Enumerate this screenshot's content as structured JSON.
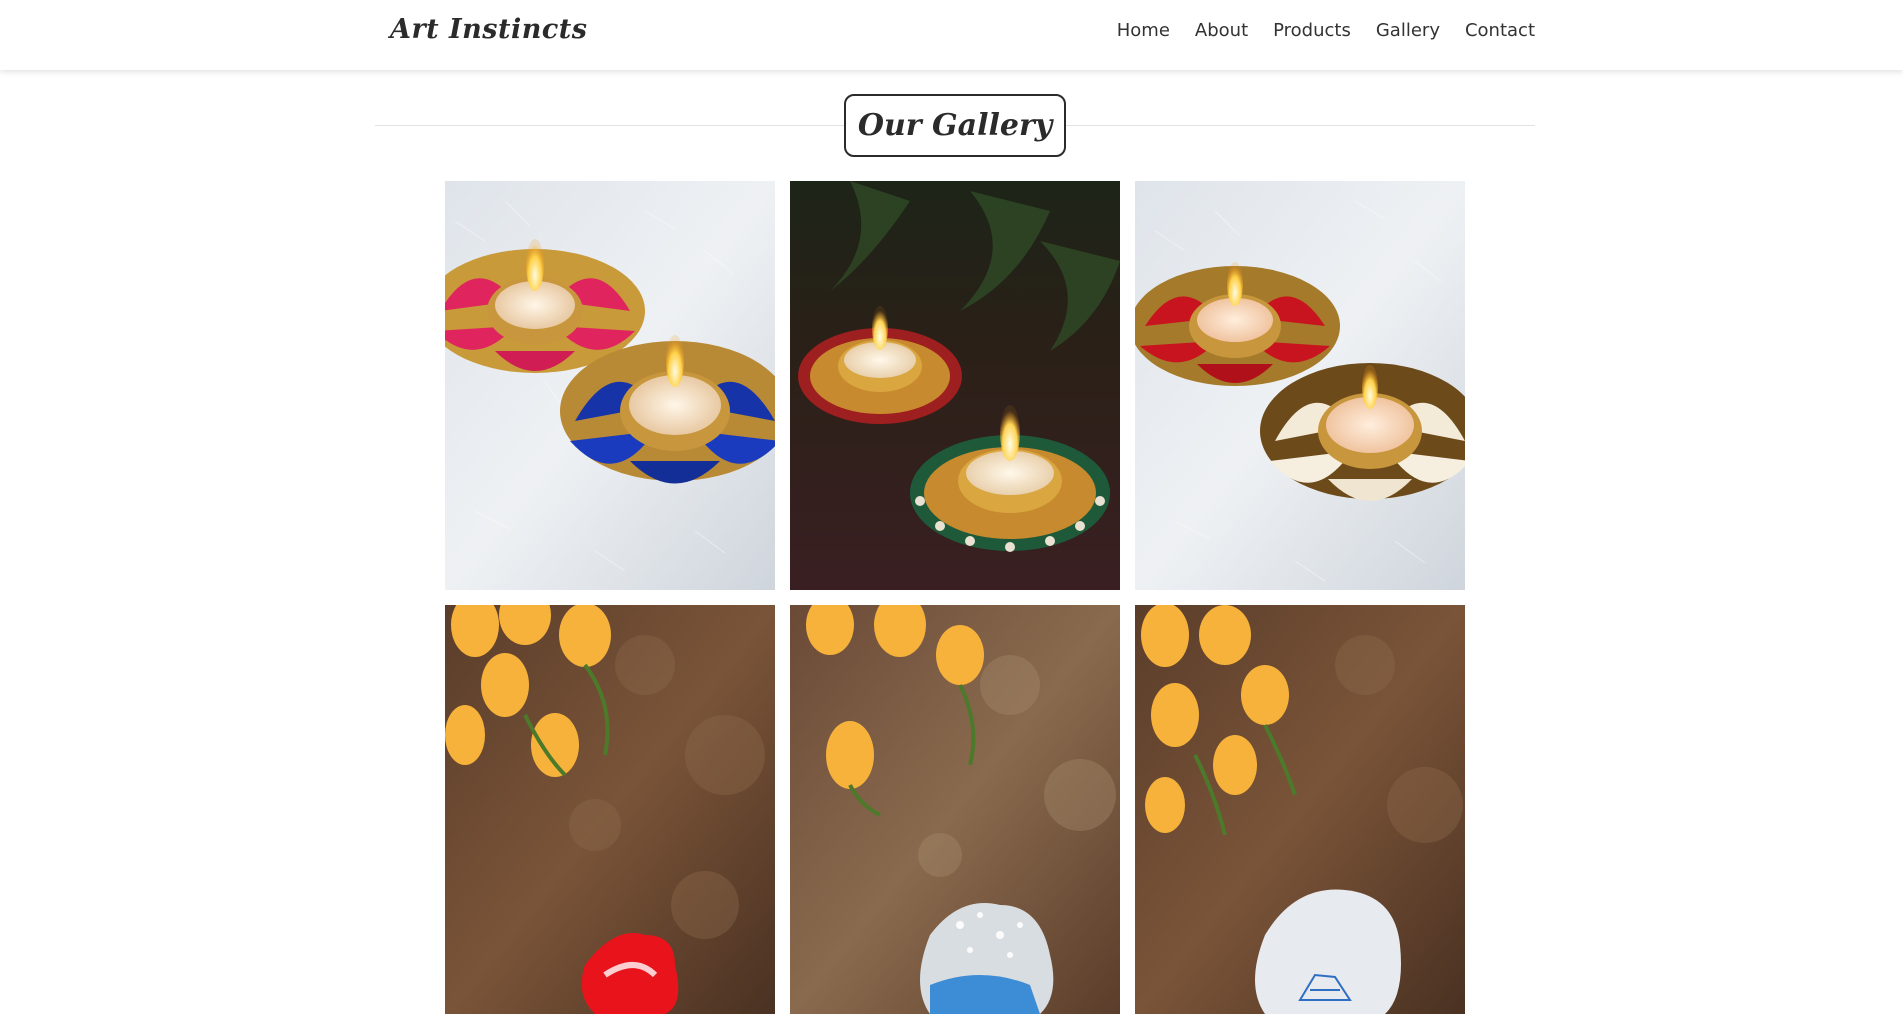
{
  "brand": {
    "name": "Art Instincts"
  },
  "nav": {
    "items": [
      {
        "label": "Home"
      },
      {
        "label": "About"
      },
      {
        "label": "Products"
      },
      {
        "label": "Gallery"
      },
      {
        "label": "Contact"
      }
    ]
  },
  "gallery": {
    "title": "Our Gallery",
    "images": [
      {
        "subject": "pink-and-blue-lotus-tealight-holders"
      },
      {
        "subject": "beaded-diya-tealight-holders"
      },
      {
        "subject": "red-and-white-lotus-tealight-holders"
      },
      {
        "subject": "red-resin-coaster-with-tulips"
      },
      {
        "subject": "blue-resin-coaster-with-tulips"
      },
      {
        "subject": "white-resin-coaster-with-tulips"
      }
    ]
  },
  "colors": {
    "text": "#333333",
    "fur_white": "#e9ecf0",
    "lotus_pink": "#e0245e",
    "lotus_blue": "#1733a8",
    "lotus_red": "#c8141e",
    "gold": "#c99a3a",
    "tulip_yellow": "#f7b23b",
    "stone_brown": "#6b4a33"
  }
}
